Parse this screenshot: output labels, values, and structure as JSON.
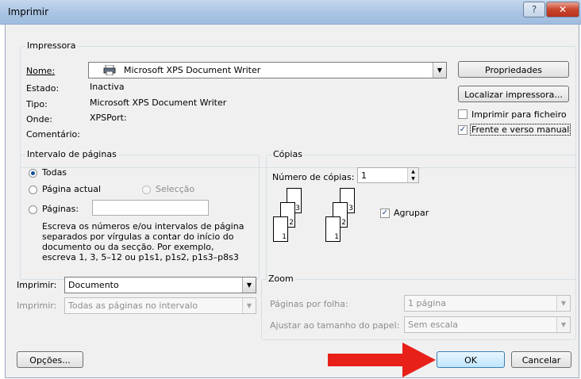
{
  "window": {
    "title": "Imprimir",
    "help_glyph": "?",
    "close_glyph": "✕"
  },
  "printer": {
    "group_label": "Impressora",
    "name_label": "Nome:",
    "name_value": "Microsoft XPS Document Writer",
    "status_label": "Estado:",
    "status_value": "Inactiva",
    "type_label": "Tipo:",
    "type_value": "Microsoft XPS Document Writer",
    "where_label": "Onde:",
    "where_value": "XPSPort:",
    "comment_label": "Comentário:",
    "properties_button": "Propriedades",
    "find_printer_button": "Localizar impressora...",
    "print_to_file_label": "Imprimir para ficheiro",
    "print_to_file_checked": false,
    "duplex_label": "Frente e verso manual",
    "duplex_checked": true
  },
  "page_range": {
    "group_label": "Intervalo de páginas",
    "all_label": "Todas",
    "current_label": "Página actual",
    "selection_label": "Selecção",
    "pages_label": "Páginas:",
    "pages_value": "",
    "help_text": "Escreva os números e/ou intervalos de página separados por vírgulas a contar do início do documento ou da secção. Por exemplo, escreva 1, 3, 5–12 ou p1s1, p1s2, p1s3–p8s3",
    "selected": "all"
  },
  "copies": {
    "group_label": "Cópias",
    "count_label": "Número de cópias:",
    "count_value": "1",
    "collate_label": "Agrupar",
    "collate_checked": true,
    "page_numbers": [
      "1",
      "2",
      "3"
    ]
  },
  "print_what": {
    "label": "Imprimir:",
    "value": "Documento",
    "pages_label": "Imprimir:",
    "pages_value": "Todas as páginas no intervalo"
  },
  "zoom": {
    "group_label": "Zoom",
    "pages_per_sheet_label": "Páginas por folha:",
    "pages_per_sheet_value": "1 página",
    "scale_label": "Ajustar ao tamanho do papel:",
    "scale_value": "Sem escala"
  },
  "footer": {
    "options_button": "Opções...",
    "ok_button": "OK",
    "cancel_button": "Cancelar"
  },
  "colors": {
    "arrow": "#e8201a",
    "checkmark": "#1f3f83"
  }
}
